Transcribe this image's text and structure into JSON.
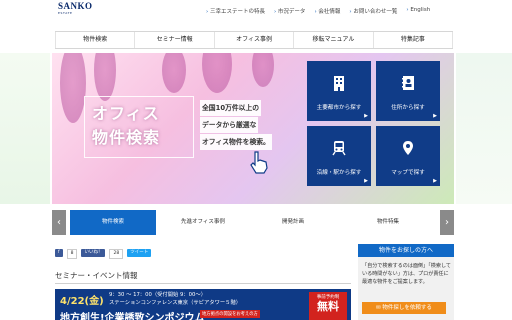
{
  "header": {
    "logo_main": "SANKO",
    "logo_sub": "ESTATE",
    "links": [
      "三幸エステートの特長",
      "市況データ",
      "会社情報",
      "お問い合わせ一覧",
      "English"
    ]
  },
  "nav": [
    "物件検索",
    "セミナー情報",
    "オフィス事例",
    "移転マニュアル",
    "特集記事"
  ],
  "hero": {
    "copy_line1": "オフィス",
    "copy_line2": "物件検索",
    "sub_lines": [
      "全国10万件以上の",
      "データから厳選な",
      "オフィス物件を検索。"
    ],
    "tiles": [
      {
        "label": "主要都市から探す",
        "icon": "building-icon"
      },
      {
        "label": "住所から探す",
        "icon": "address-book-icon"
      },
      {
        "label": "沿線・駅から探す",
        "icon": "train-icon"
      },
      {
        "label": "マップで探す",
        "icon": "map-pin-icon"
      }
    ],
    "tile_color": "#103c88"
  },
  "tabs": {
    "items": [
      "物件検索",
      "先進オフィス事例",
      "開発計画",
      "物件特集"
    ],
    "active_index": 0,
    "active_color": "#1169c6"
  },
  "social": {
    "fb_label": "f",
    "fb_count": "8",
    "like_label": "いいね！",
    "like_count": "28",
    "tweet_label": "ツイート"
  },
  "seminar": {
    "heading": "セミナー・イベント情報",
    "date": "4/22(金)",
    "time_line1": "9：30 ～ 17：00（受付開始 9：00～）",
    "time_line2": "ステーションコンファレンス東京（サピアタワー５階）",
    "title": "地方創生!企業誘致シンポジウム",
    "subtitle": "地方拠点の開設をお考えの方",
    "badge_top": "事前予約制",
    "badge_main": "無料"
  },
  "side": {
    "heading": "物件をお探しの方へ",
    "text": "「自分で検索するのは面倒」「検索している時間がない」方は、プロが責任に最適な物件をご提案します。",
    "button": "物件探しを依頼する"
  }
}
